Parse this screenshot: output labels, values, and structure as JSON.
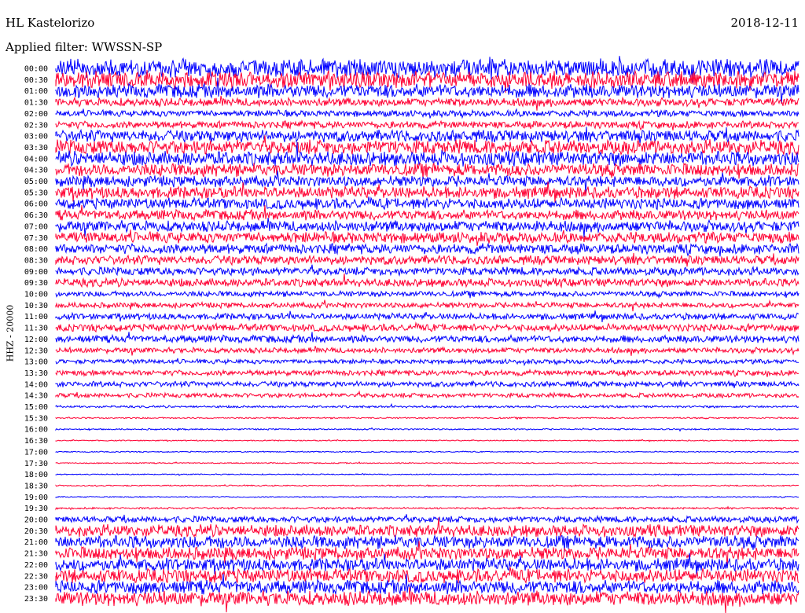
{
  "header": {
    "station": "HL Kastelorizo",
    "date": "2018-12-11",
    "filter": "Applied filter: WWSSN-SP"
  },
  "chart_data": {
    "type": "line",
    "title": "HL Kastelorizo",
    "ylabel": "HHZ - 20000",
    "row_labels": [
      "00:00",
      "00:30",
      "01:00",
      "01:30",
      "02:00",
      "02:30",
      "03:00",
      "03:30",
      "04:00",
      "04:30",
      "05:00",
      "05:30",
      "06:00",
      "06:30",
      "07:00",
      "07:30",
      "08:00",
      "08:30",
      "09:00",
      "09:30",
      "10:00",
      "10:30",
      "11:00",
      "11:30",
      "12:00",
      "12:30",
      "13:00",
      "13:30",
      "14:00",
      "14:30",
      "15:00",
      "15:30",
      "16:00",
      "16:30",
      "17:00",
      "17:30",
      "18:00",
      "18:30",
      "19:00",
      "19:30",
      "20:00",
      "20:30",
      "21:00",
      "21:30",
      "22:00",
      "22:30",
      "23:00",
      "23:30"
    ],
    "series_colors": [
      "#0000ff",
      "#ff0033"
    ],
    "relative_amplitude": [
      1.0,
      0.9,
      0.75,
      0.45,
      0.35,
      0.4,
      0.65,
      0.8,
      0.8,
      0.7,
      0.6,
      0.65,
      0.6,
      0.55,
      0.6,
      0.6,
      0.55,
      0.5,
      0.45,
      0.45,
      0.3,
      0.3,
      0.35,
      0.4,
      0.4,
      0.3,
      0.25,
      0.3,
      0.3,
      0.25,
      0.12,
      0.08,
      0.08,
      0.06,
      0.06,
      0.06,
      0.06,
      0.07,
      0.06,
      0.1,
      0.35,
      0.65,
      0.7,
      0.7,
      0.7,
      0.75,
      0.75,
      0.8
    ],
    "grid": false
  }
}
